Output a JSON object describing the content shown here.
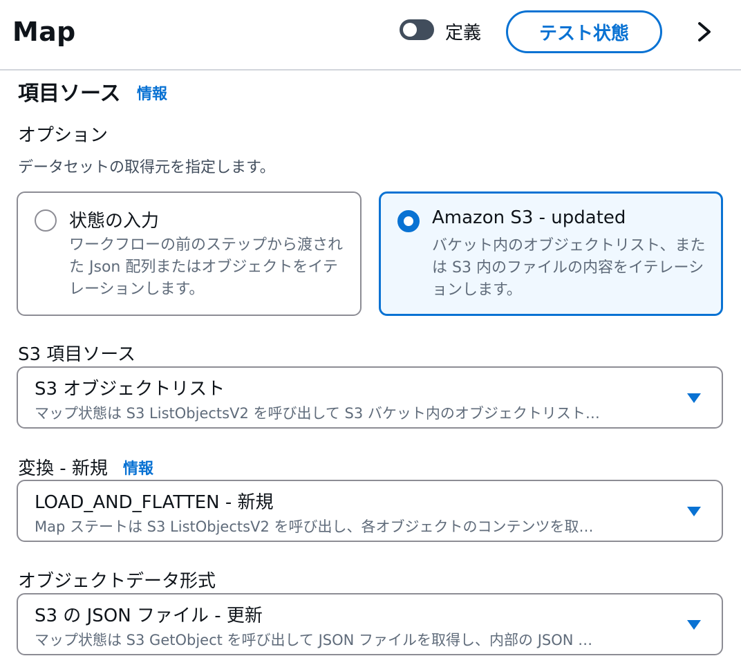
{
  "header": {
    "title": "Map",
    "toggle_label": "定義",
    "test_button": "テスト状態"
  },
  "section": {
    "title": "項目ソース",
    "info": "情報"
  },
  "options": {
    "label": "オプション",
    "description": "データセットの取得元を指定します。",
    "tiles": [
      {
        "title": "状態の入力",
        "description": "ワークフローの前のステップから渡された Json 配列またはオブジェクトをイテレーションします。",
        "selected": false
      },
      {
        "title": "Amazon S3 - updated",
        "description": "バケット内のオブジェクトリスト、または S3 内のファイルの内容をイテレーションします。",
        "selected": true
      }
    ]
  },
  "s3_source": {
    "label": "S3 項目ソース",
    "value": "S3 オブジェクトリスト",
    "sub": "マップ状態は S3 ListObjectsV2 を呼び出して S3 バケット内のオブジェクトリスト…"
  },
  "transform": {
    "label": "変換 - 新規",
    "info": "情報",
    "value": "LOAD_AND_FLATTEN - 新規",
    "sub": "Map ステートは S3 ListObjectsV2 を呼び出し、各オブジェクトのコンテンツを取…"
  },
  "data_format": {
    "label": "オブジェクトデータ形式",
    "value": "S3 の JSON ファイル - 更新",
    "sub": "マップ状態は S3 GetObject を呼び出して JSON ファイルを取得し、内部の JSON …"
  },
  "colors": {
    "accent": "#0972d3",
    "text": "#0f141a",
    "secondary_text": "#5f6b7a",
    "border": "#8c8c94",
    "selected_bg": "#f0f8ff"
  }
}
